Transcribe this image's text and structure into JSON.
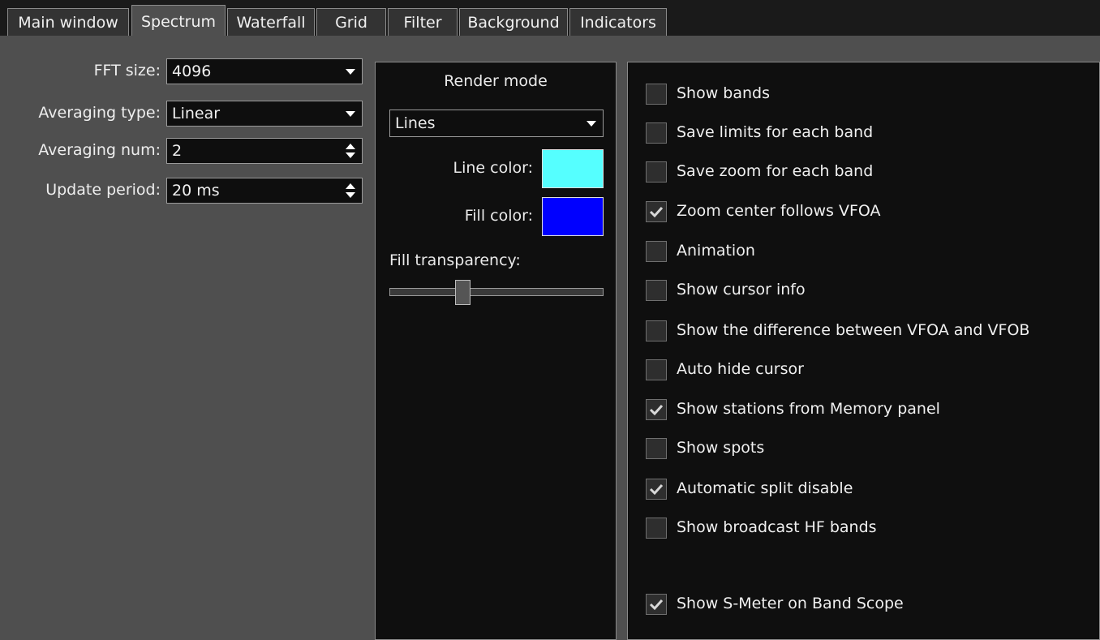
{
  "tabs": [
    {
      "label": "Main window"
    },
    {
      "label": "Spectrum"
    },
    {
      "label": "Waterfall"
    },
    {
      "label": "Grid"
    },
    {
      "label": "Filter"
    },
    {
      "label": "Background"
    },
    {
      "label": "Indicators"
    }
  ],
  "active_tab": "Spectrum",
  "fft": {
    "fft_size": {
      "label": "FFT size:",
      "value": "4096"
    },
    "averaging_type": {
      "label": "Averaging type:",
      "value": "Linear"
    },
    "averaging_num": {
      "label": "Averaging num:",
      "value": "2"
    },
    "update_period": {
      "label": "Update period:",
      "value": "20 ms"
    }
  },
  "render": {
    "title": "Render mode",
    "mode": "Lines",
    "line_color_label": "Line color:",
    "line_color": "#55ffff",
    "fill_color_label": "Fill color:",
    "fill_color": "#0000ff",
    "fill_transparency_label": "Fill transparency:",
    "fill_transparency_fraction": 0.33
  },
  "options": [
    {
      "label": "Show bands",
      "checked": false
    },
    {
      "label": "Save limits for each band",
      "checked": false
    },
    {
      "label": "Save zoom for each band",
      "checked": false
    },
    {
      "label": "Zoom center follows VFOA",
      "checked": true
    },
    {
      "label": "Animation",
      "checked": false
    },
    {
      "label": "Show cursor info",
      "checked": false
    },
    {
      "label": "Show the difference between VFOA and VFOB",
      "checked": false
    },
    {
      "label": "Auto hide cursor",
      "checked": false
    },
    {
      "label": "Show stations from Memory panel",
      "checked": true
    },
    {
      "label": "Show spots",
      "checked": false
    },
    {
      "label": "Automatic split disable",
      "checked": true
    },
    {
      "label": "Show broadcast HF bands",
      "checked": false
    },
    {
      "label": "Show S-Meter on Band Scope",
      "checked": true
    }
  ],
  "colors": {
    "background": "#4f4f4f",
    "panel": "#0f0f0f",
    "tabbar": "#1a1a1a"
  }
}
